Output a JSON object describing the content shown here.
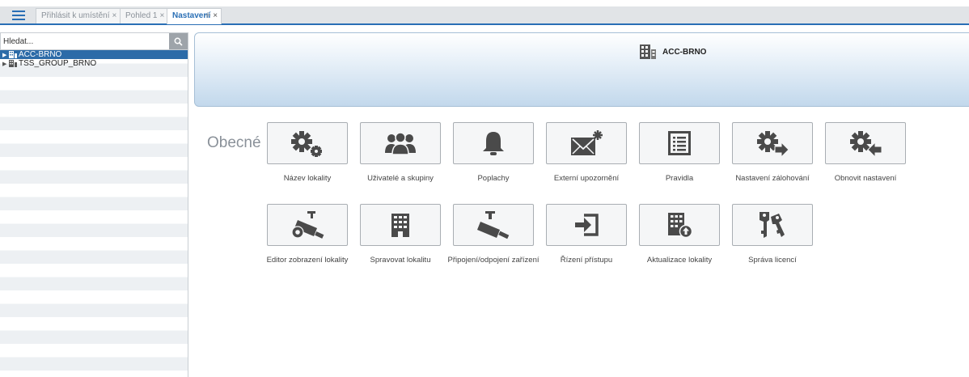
{
  "tabs": [
    {
      "label": "Přihlásit k umístění",
      "close": "×"
    },
    {
      "label": "Pohled 1",
      "close": "×"
    },
    {
      "label": "Nastavení",
      "close": "×"
    }
  ],
  "add_tab": "+",
  "search": {
    "placeholder": "Hledat..."
  },
  "tree": {
    "items": [
      {
        "label": "ACC-BRNO",
        "selected": true
      },
      {
        "label": "TSS_GROUP_BRNO",
        "selected": false
      }
    ]
  },
  "header": {
    "title": "ACC-BRNO"
  },
  "section": {
    "title": "Obecné"
  },
  "settings": [
    {
      "label": "Název lokality",
      "icon": "gears-icon"
    },
    {
      "label": "Uživatelé a skupiny",
      "icon": "users-icon"
    },
    {
      "label": "Poplachy",
      "icon": "bell-icon"
    },
    {
      "label": "Externí upozornění",
      "icon": "envelope-star-icon"
    },
    {
      "label": "Pravidla",
      "icon": "list-icon"
    },
    {
      "label": "Nastavení zálohování",
      "icon": "gear-arrow-right-icon"
    },
    {
      "label": "Obnovit nastavení",
      "icon": "gear-arrow-left-icon"
    },
    {
      "label": "Editor zobrazení lokality",
      "icon": "camera-gear-icon"
    },
    {
      "label": "Spravovat lokalitu",
      "icon": "building-icon"
    },
    {
      "label": "Připojení/odpojení zařízení",
      "icon": "camera-icon"
    },
    {
      "label": "Řízení přístupu",
      "icon": "login-icon"
    },
    {
      "label": "Aktualizace lokality",
      "icon": "building-upload-icon"
    },
    {
      "label": "Správa licencí",
      "icon": "keys-icon"
    }
  ],
  "colors": {
    "accent": "#2a6fb5",
    "selected_row": "#2c6ba8",
    "icon": "#4a4a4a"
  }
}
